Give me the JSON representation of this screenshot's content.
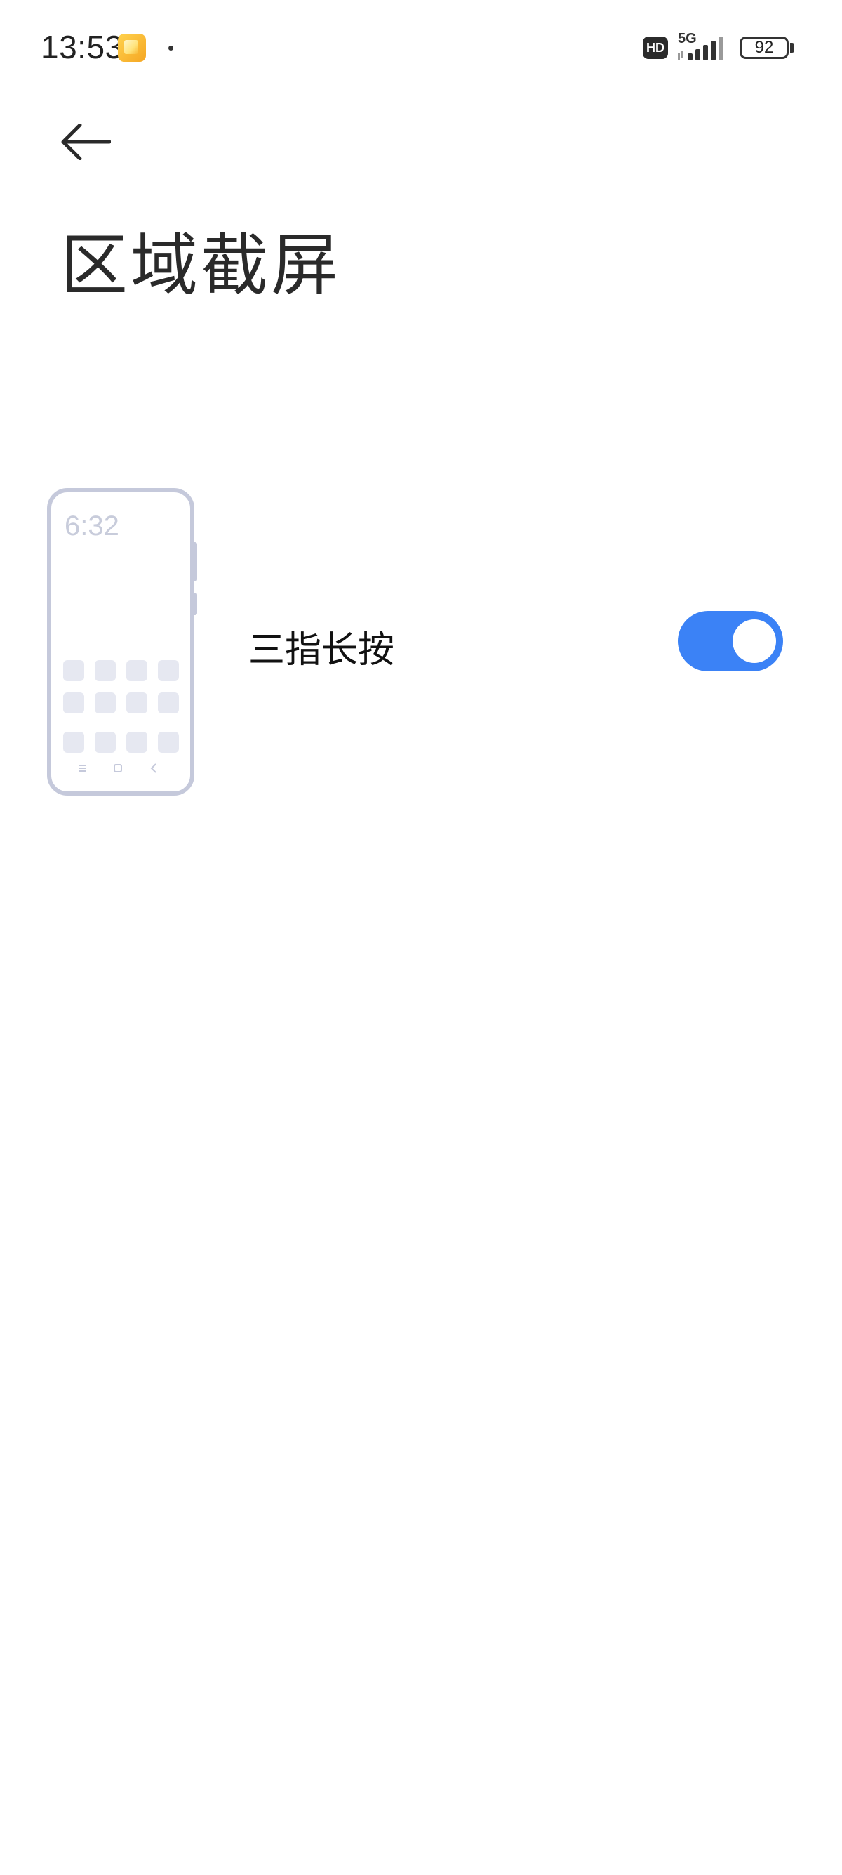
{
  "status_bar": {
    "time": "13:53",
    "hd_label": "HD",
    "network_label": "5G",
    "battery_level": "92"
  },
  "header": {
    "back_icon": "arrow-left-icon",
    "title": "区域截屏"
  },
  "setting": {
    "label": "三指长按",
    "enabled": true,
    "illustration": {
      "clock": "6:32"
    }
  },
  "colors": {
    "accent": "#3b82f6",
    "illustration_outline": "#c5c9db",
    "app_tile": "#e6e8f1"
  }
}
